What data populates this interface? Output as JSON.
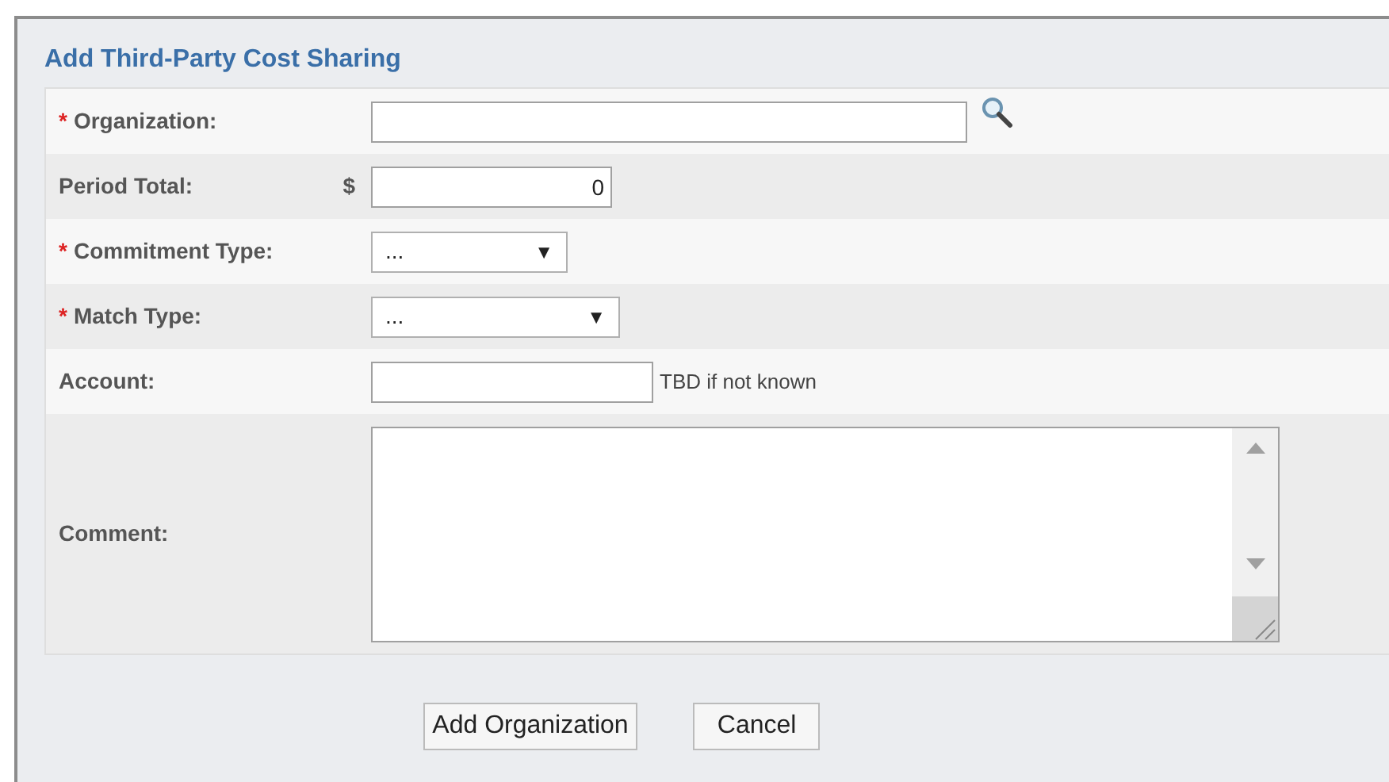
{
  "dialog": {
    "title": "Add Third-Party Cost Sharing"
  },
  "fields": [
    {
      "kind": "lookup",
      "label": "Organization:",
      "required": true
    },
    {
      "kind": "currency",
      "label": "Period Total:",
      "required": false,
      "prefix": "$",
      "value": "0"
    },
    {
      "kind": "select",
      "label": "Commitment Type:",
      "required": true,
      "value": "...",
      "arrow": "▼"
    },
    {
      "kind": "select",
      "label": "Match Type:",
      "required": true,
      "value": "...",
      "arrow": "▼"
    },
    {
      "kind": "text",
      "label": "Account:",
      "required": false,
      "hint": "TBD if not known"
    },
    {
      "kind": "textarea",
      "label": "Comment:",
      "required": false
    }
  ],
  "required_mark": "*",
  "buttons": [
    "Add Organization",
    "Cancel"
  ]
}
